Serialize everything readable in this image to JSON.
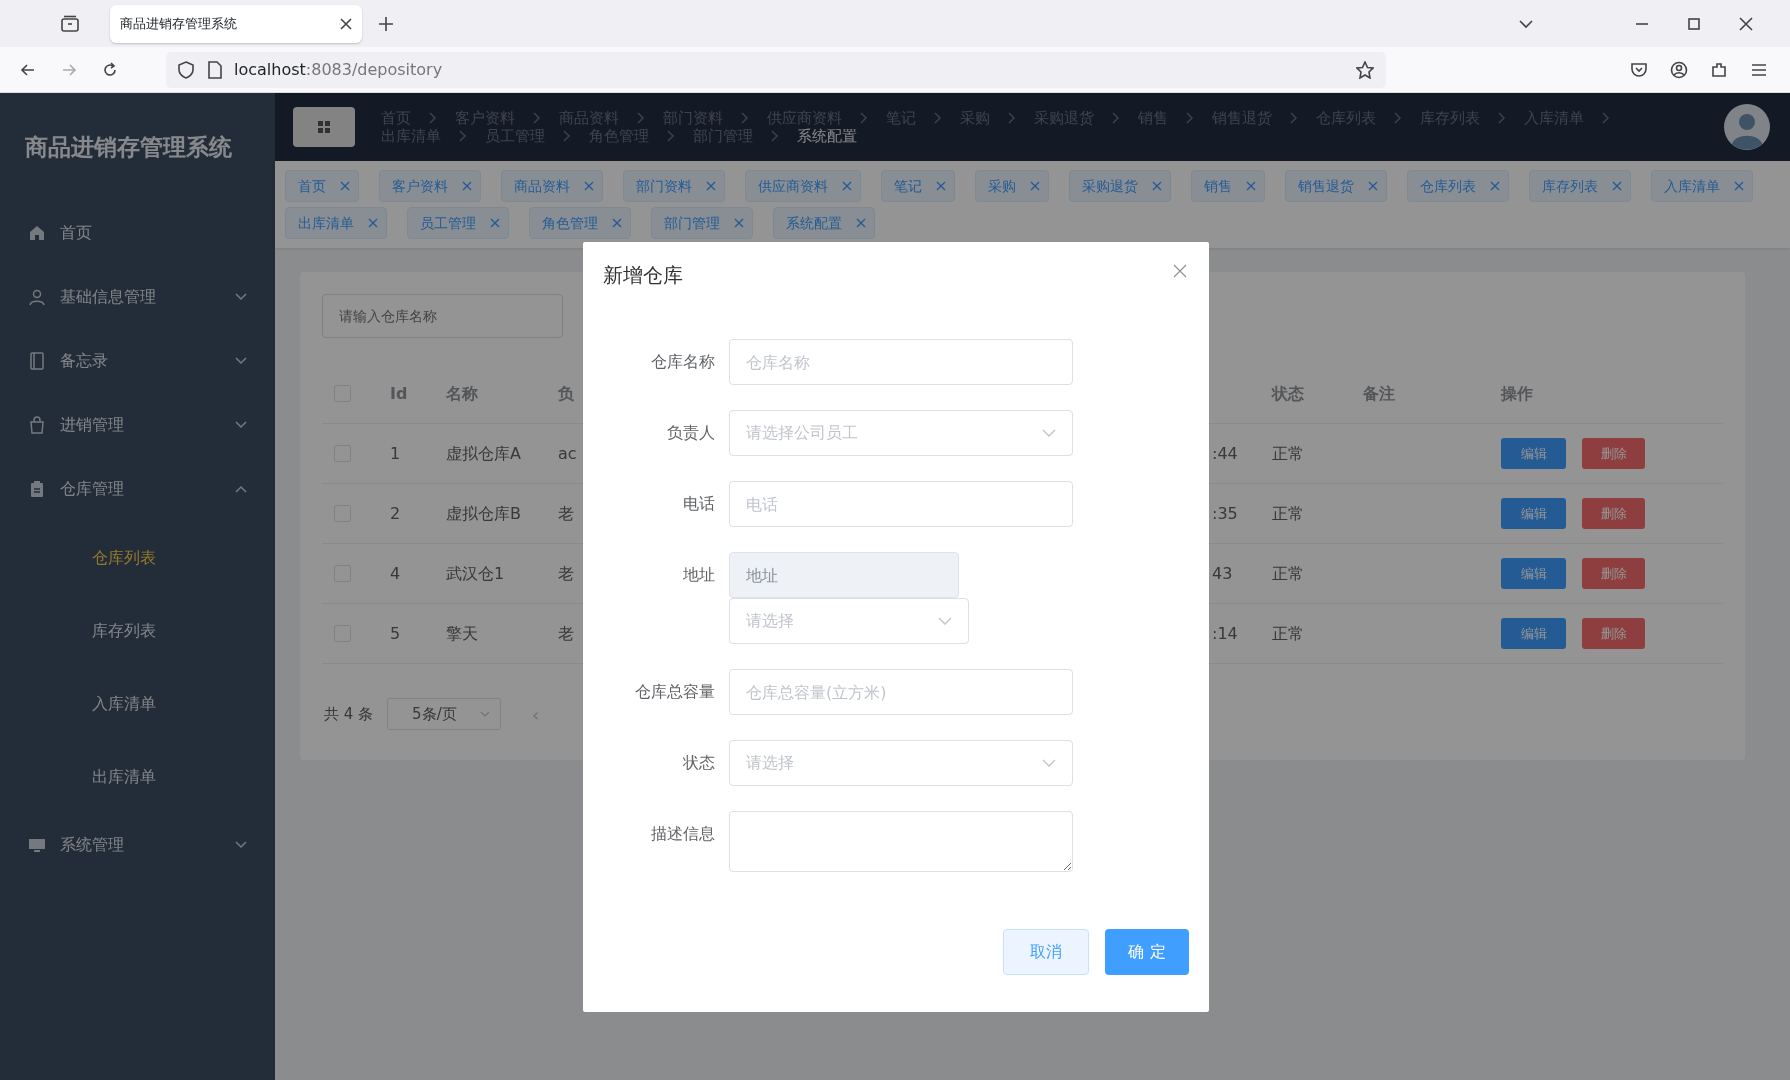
{
  "browser": {
    "tab_title": "商品进销存管理系统",
    "url_host": "localhost",
    "url_path": ":8083/depository"
  },
  "sidebar": {
    "title": "商品进销存管理系统",
    "items": [
      {
        "label": "首页",
        "kind": "link",
        "selected": false
      },
      {
        "label": "基础信息管理",
        "kind": "group",
        "expanded": false,
        "selected": false
      },
      {
        "label": "备忘录",
        "kind": "group",
        "expanded": false,
        "selected": false
      },
      {
        "label": "进销管理",
        "kind": "group",
        "expanded": false,
        "selected": false
      },
      {
        "label": "仓库管理",
        "kind": "group",
        "expanded": true,
        "selected": false,
        "children": [
          {
            "label": "仓库列表",
            "selected": true
          },
          {
            "label": "库存列表",
            "selected": false
          },
          {
            "label": "入库清单",
            "selected": false
          },
          {
            "label": "出库清单",
            "selected": false
          }
        ]
      },
      {
        "label": "系统管理",
        "kind": "group",
        "expanded": false,
        "selected": false
      }
    ]
  },
  "breadcrumb": [
    "首页",
    "客户资料",
    "商品资料",
    "部门资料",
    "供应商资料",
    "笔记",
    "采购",
    "采购退货",
    "销售",
    "销售退货",
    "仓库列表",
    "库存列表",
    "入库清单",
    "出库清单",
    "员工管理",
    "角色管理",
    "部门管理",
    "系统配置"
  ],
  "tags": [
    "首页",
    "客户资料",
    "商品资料",
    "部门资料",
    "供应商资料",
    "笔记",
    "采购",
    "采购退货",
    "销售",
    "销售退货",
    "仓库列表",
    "库存列表",
    "入库清单",
    "出库清单",
    "员工管理",
    "角色管理",
    "部门管理",
    "系统配置"
  ],
  "search": {
    "placeholder": "请输入仓库名称"
  },
  "table": {
    "all_checked": false,
    "columns": [
      "Id",
      "名称",
      "负",
      "状态",
      "备注",
      "操作"
    ],
    "rows": [
      {
        "id": "1",
        "name": "虚拟仓库A",
        "column_4": "ac",
        "column_5": ":44",
        "status": "正常",
        "actions": [
          "编辑",
          "删除"
        ],
        "checked": false
      },
      {
        "id": "2",
        "name": "虚拟仓库B",
        "column_4": "老",
        "column_5": ":35",
        "status": "正常",
        "actions": [
          "编辑",
          "删除"
        ],
        "checked": false
      },
      {
        "id": "4",
        "name": "武汉仓1",
        "column_4": "老",
        "column_5": "43",
        "status": "正常",
        "actions": [
          "编辑",
          "删除"
        ],
        "checked": false
      },
      {
        "id": "5",
        "name": "擎天",
        "column_4": "老",
        "column_5": ":14",
        "status": "正常",
        "actions": [
          "编辑",
          "删除"
        ],
        "checked": false
      }
    ]
  },
  "pagination": {
    "total": "共 4 条",
    "page_size": "5条/页",
    "prev": "‹"
  },
  "dialog": {
    "title": "新增仓库",
    "fields": [
      {
        "label": "仓库名称",
        "kind": "input",
        "placeholder": "仓库名称",
        "disabled": false
      },
      {
        "label": "负责人",
        "kind": "select",
        "placeholder": "请选择公司员工",
        "disabled": false
      },
      {
        "label": "电话",
        "kind": "input",
        "placeholder": "电话",
        "disabled": false
      },
      {
        "label": "地址",
        "kind": "address",
        "placeholder": "地址",
        "select_placeholder": "请选择",
        "disabled": true
      },
      {
        "label": "仓库总容量",
        "kind": "input",
        "placeholder": "仓库总容量(立方米)",
        "disabled": false
      },
      {
        "label": "状态",
        "kind": "select",
        "placeholder": "请选择",
        "disabled": false
      },
      {
        "label": "描述信息",
        "kind": "textarea",
        "disabled": false
      }
    ],
    "buttons": [
      {
        "label": "取消",
        "kind": "cancel",
        "hovered": true
      },
      {
        "label": "确 定",
        "kind": "primary",
        "hovered": false
      }
    ]
  }
}
